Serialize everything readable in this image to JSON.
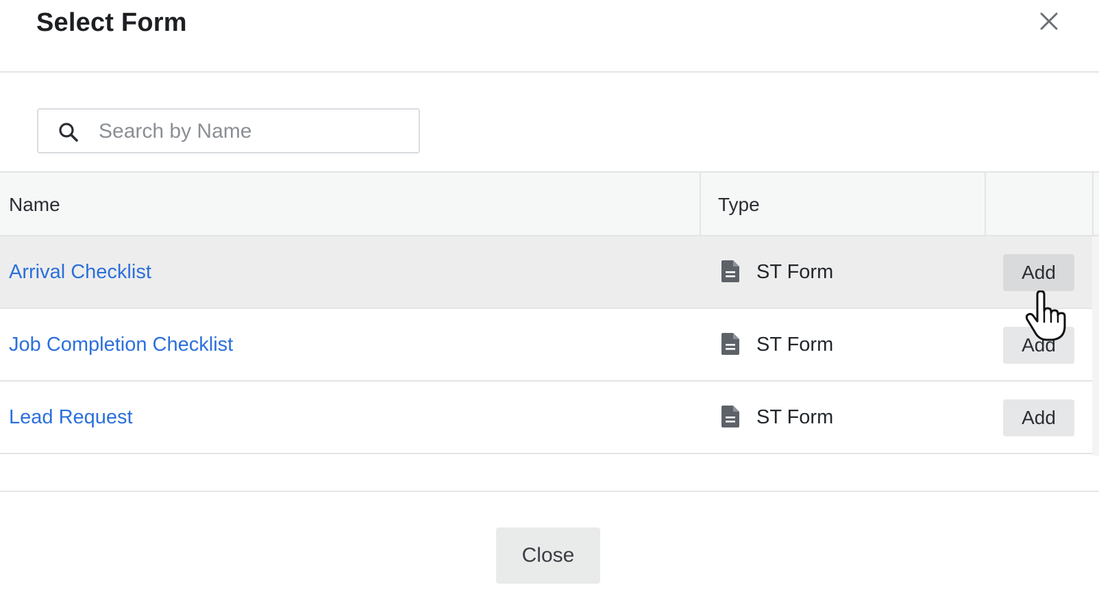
{
  "dialog": {
    "title": "Select Form",
    "close_icon": "close-icon"
  },
  "search": {
    "placeholder": "Search by Name",
    "value": "",
    "icon": "search-icon"
  },
  "table": {
    "columns": [
      "Name",
      "Type",
      ""
    ],
    "rows": [
      {
        "name": "Arrival Checklist",
        "type": "ST Form",
        "type_icon": "document-icon",
        "action": "Add",
        "hovered": true
      },
      {
        "name": "Job Completion Checklist",
        "type": "ST Form",
        "type_icon": "document-icon",
        "action": "Add",
        "hovered": false
      },
      {
        "name": "Lead Request",
        "type": "ST Form",
        "type_icon": "document-icon",
        "action": "Add",
        "hovered": false
      }
    ]
  },
  "footer": {
    "close_label": "Close"
  },
  "colors": {
    "link": "#2b6fdc",
    "hover_row": "#ededed",
    "button_bg": "#e6e7e8"
  }
}
